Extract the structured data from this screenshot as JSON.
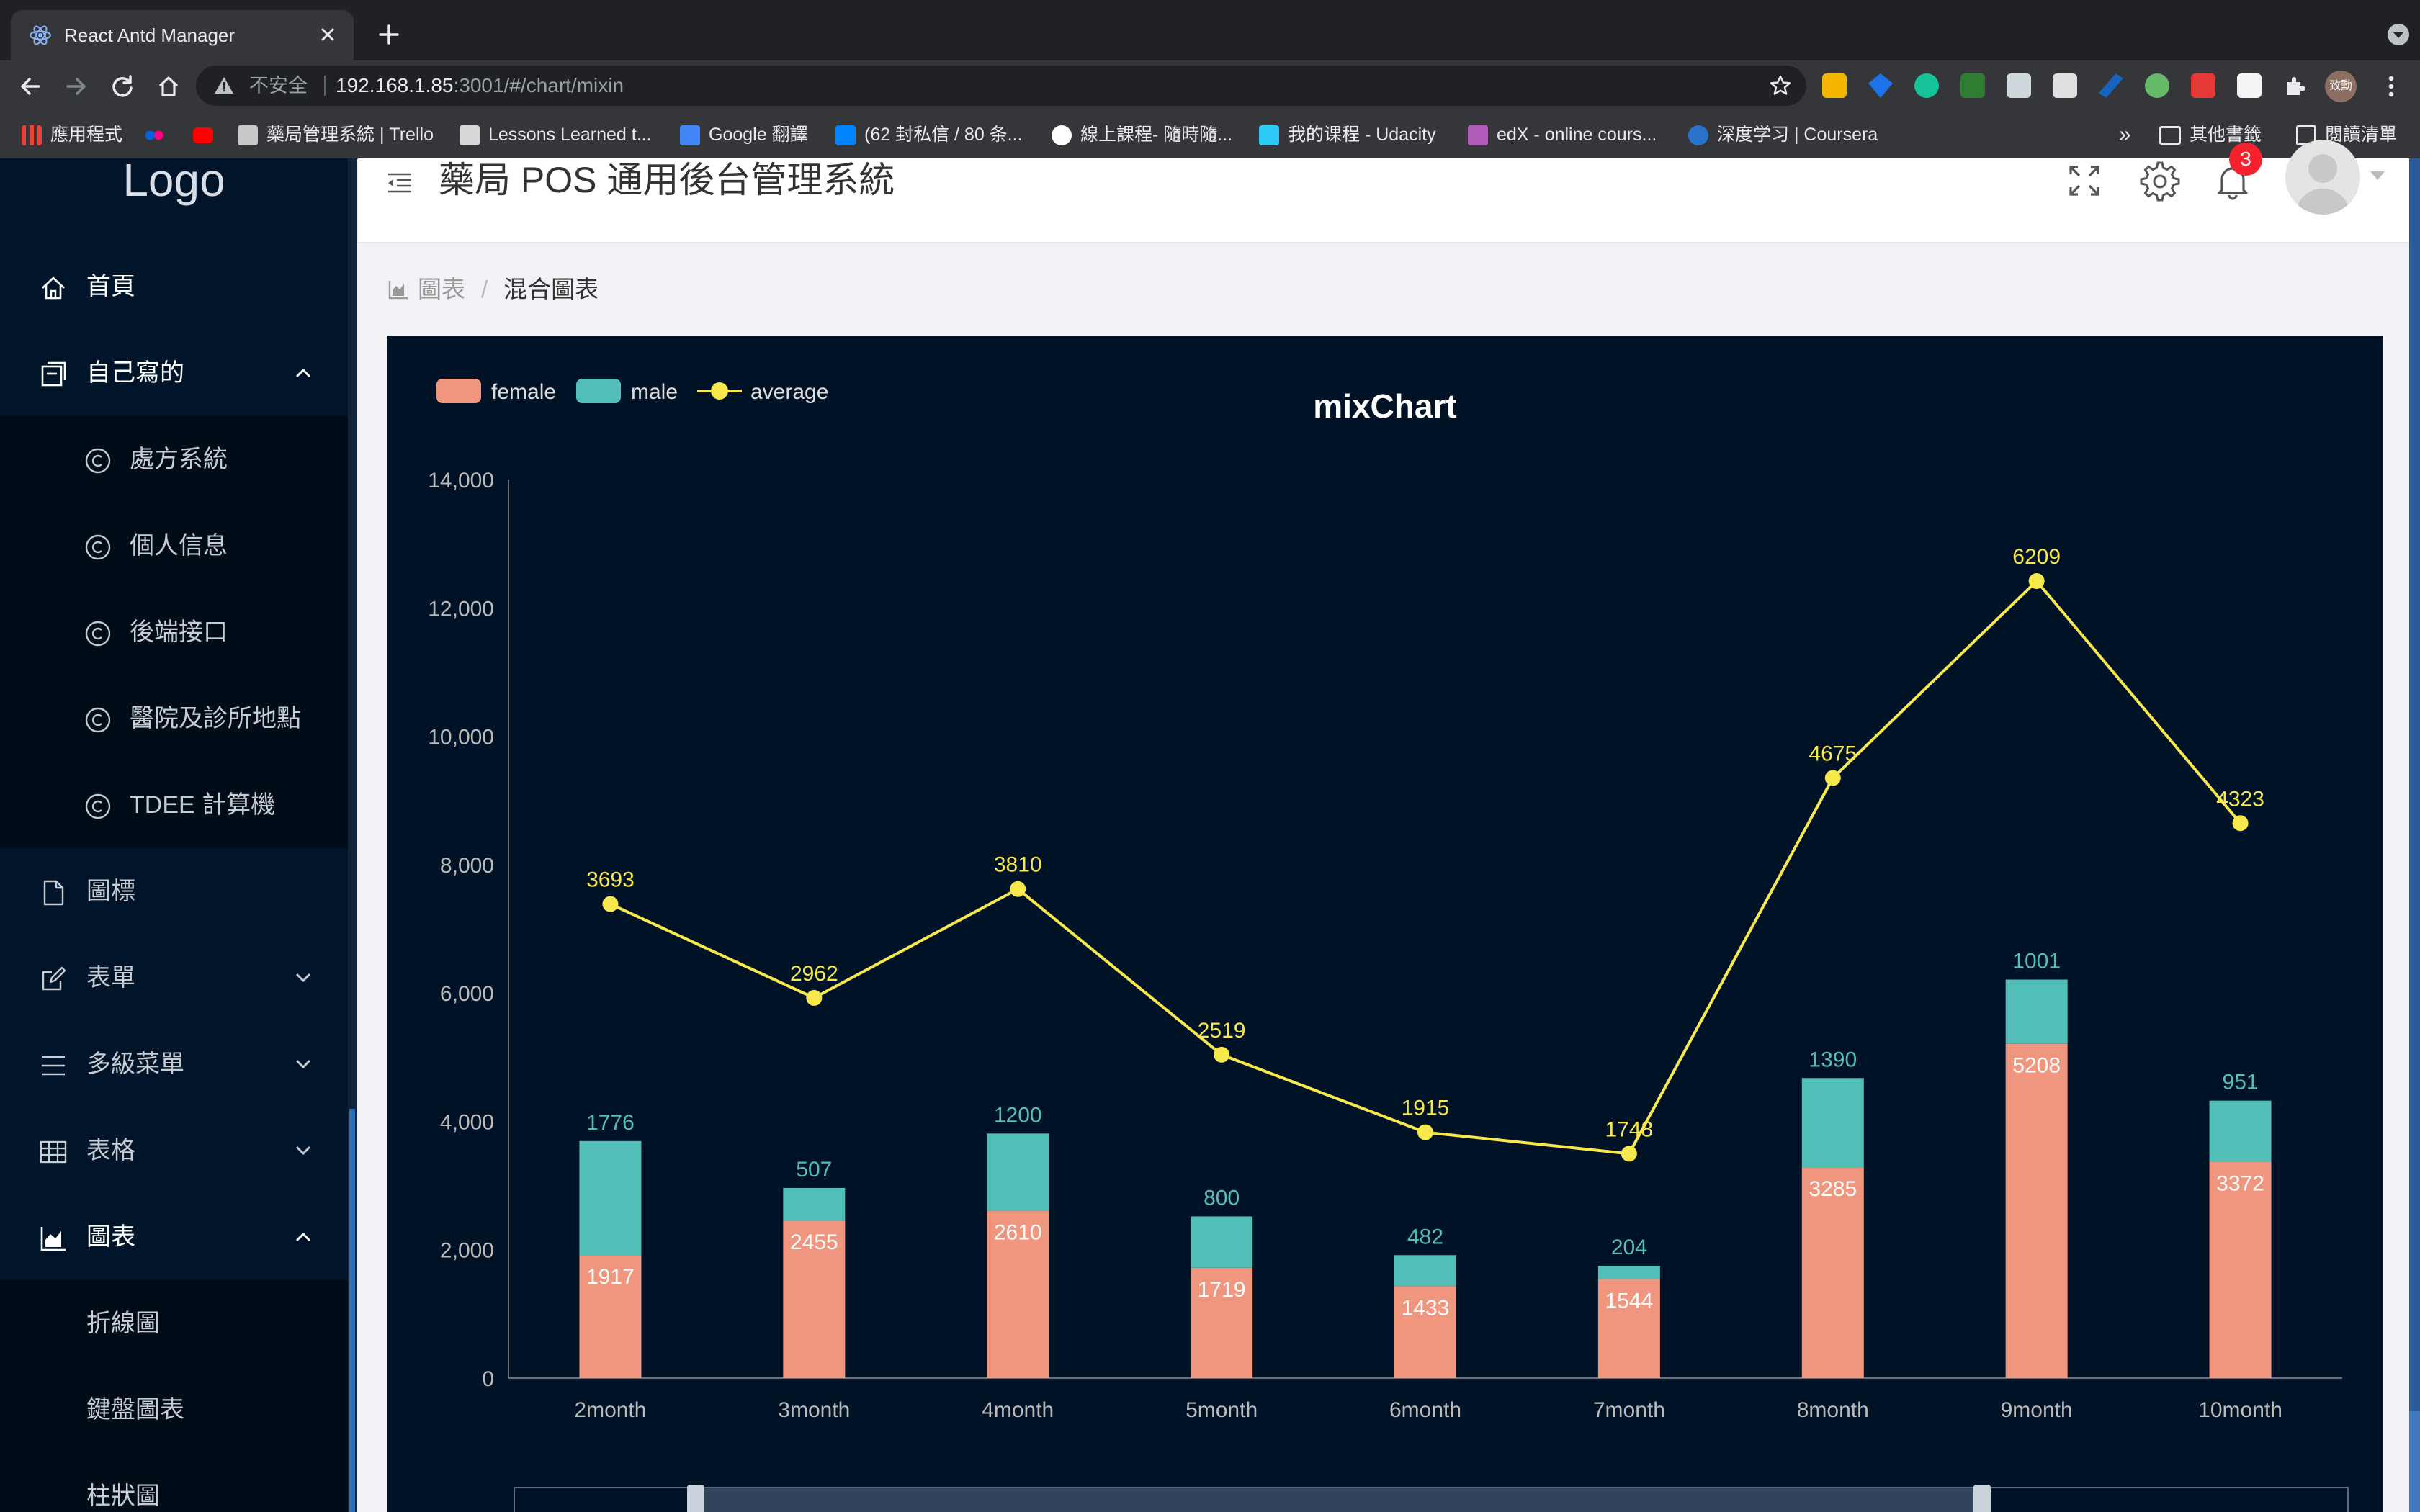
{
  "browser": {
    "tab_title": "React Antd Manager",
    "security_label": "不安全",
    "url_host": "192.168.1.85",
    "url_rest": ":3001/#/chart/mixin",
    "profile_label": "致勳",
    "bookmarks": [
      {
        "label": "應用程式",
        "icon": "apps-grid-icon",
        "color": "#ea4335"
      },
      {
        "label": "",
        "icon": "flickr-icon",
        "color": "#e91e63"
      },
      {
        "label": "",
        "icon": "youtube-icon",
        "color": "#ff0000"
      },
      {
        "label": "藥局管理系統 | Trello",
        "icon": "trello-icon",
        "color": "#cccccc"
      },
      {
        "label": "Lessons Learned t...",
        "icon": "page-icon",
        "color": "#cccccc"
      },
      {
        "label": "Google 翻譯",
        "icon": "google-translate-icon",
        "color": "#4285f4"
      },
      {
        "label": "(62 封私信 / 80 条...",
        "icon": "zhihu-icon",
        "color": "#0084ff"
      },
      {
        "label": "線上課程- 隨時隨...",
        "icon": "udemy-icon",
        "color": "#ffffff"
      },
      {
        "label": "我的课程 - Udacity",
        "icon": "udacity-icon",
        "color": "#2ec8f7"
      },
      {
        "label": "edX - online cours...",
        "icon": "edx-icon",
        "color": "#b05ab9"
      },
      {
        "label": "深度学习 | Coursera",
        "icon": "coursera-icon",
        "color": "#2a73cc"
      }
    ],
    "bookmarks_more": "»",
    "other_bookmarks": "其他書籤",
    "reading_list": "閱讀清單"
  },
  "app": {
    "logo_text": "Logo",
    "title": "藥局 POS 通用後台管理系統",
    "notification_count": "3",
    "sidebar": {
      "items": [
        {
          "label": "首頁",
          "icon": "home-icon"
        },
        {
          "label": "自己寫的",
          "icon": "container-icon",
          "expanded": true,
          "children": [
            {
              "label": "處方系統",
              "icon": "copyright-icon"
            },
            {
              "label": "個人信息",
              "icon": "copyright-icon"
            },
            {
              "label": "後端接口",
              "icon": "copyright-icon"
            },
            {
              "label": "醫院及診所地點",
              "icon": "copyright-icon"
            },
            {
              "label": "TDEE 計算機",
              "icon": "copyright-icon"
            }
          ]
        },
        {
          "label": "圖標",
          "icon": "file-icon"
        },
        {
          "label": "表單",
          "icon": "form-edit-icon",
          "expanded": false
        },
        {
          "label": "多級菜單",
          "icon": "bars-icon",
          "expanded": false
        },
        {
          "label": "表格",
          "icon": "table-icon",
          "expanded": false
        },
        {
          "label": "圖表",
          "icon": "area-chart-icon",
          "expanded": true,
          "children": [
            {
              "label": "折線圖"
            },
            {
              "label": "鍵盤圖表"
            },
            {
              "label": "柱狀圖"
            }
          ]
        }
      ]
    },
    "breadcrumb": {
      "parent": "圖表",
      "separator": "/",
      "current": "混合圖表"
    }
  },
  "chart_data": {
    "type": "bar",
    "title": "mixChart",
    "categories": [
      "2month",
      "3month",
      "4month",
      "5month",
      "6month",
      "7month",
      "8month",
      "9month",
      "10month"
    ],
    "stacked": true,
    "series": [
      {
        "name": "female",
        "type": "bar",
        "color": "#f0967f",
        "values": [
          1917,
          2455,
          2610,
          1719,
          1433,
          1544,
          3285,
          5208,
          3372
        ]
      },
      {
        "name": "male",
        "type": "bar",
        "color": "#51bfb7",
        "values": [
          1776,
          507,
          1200,
          800,
          482,
          204,
          1390,
          1001,
          951
        ]
      },
      {
        "name": "average",
        "type": "line",
        "color": "#f7e84c",
        "values": [
          3693,
          2962,
          3810,
          2519,
          1915,
          1748,
          4675,
          6209,
          4323
        ],
        "plotted_values": [
          7386,
          5924,
          7620,
          5038,
          3830,
          3496,
          9350,
          12418,
          8646
        ]
      }
    ],
    "y_ticks": [
      "0",
      "2,000",
      "4,000",
      "6,000",
      "8,000",
      "10,000",
      "12,000",
      "14,000"
    ],
    "ylim": [
      0,
      14000
    ],
    "grid": false,
    "legend_position": "top-left",
    "has_datazoom_slider": true
  }
}
